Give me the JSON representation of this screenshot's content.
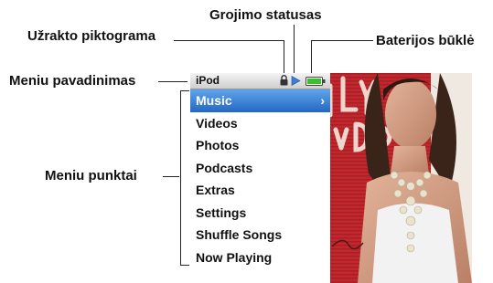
{
  "callouts": {
    "play_status": "Grojimo statusas",
    "lock_icon": "Užrakto piktograma",
    "battery": "Baterijos būklė",
    "menu_title": "Meniu pavadinimas",
    "menu_items": "Meniu punktai"
  },
  "screen": {
    "title": "iPod",
    "menu": [
      {
        "label": "Music",
        "selected": true
      },
      {
        "label": "Videos"
      },
      {
        "label": "Photos"
      },
      {
        "label": "Podcasts"
      },
      {
        "label": "Extras"
      },
      {
        "label": "Settings"
      },
      {
        "label": "Shuffle Songs"
      },
      {
        "label": "Now Playing"
      }
    ],
    "chevron": "›",
    "icons": [
      "lock-icon",
      "play-icon",
      "battery-icon"
    ],
    "colors": {
      "highlight": "#2f78d6",
      "play": "#3b7fd9",
      "battery": "#3bbf2e",
      "album_bg": "#c2272e"
    }
  }
}
